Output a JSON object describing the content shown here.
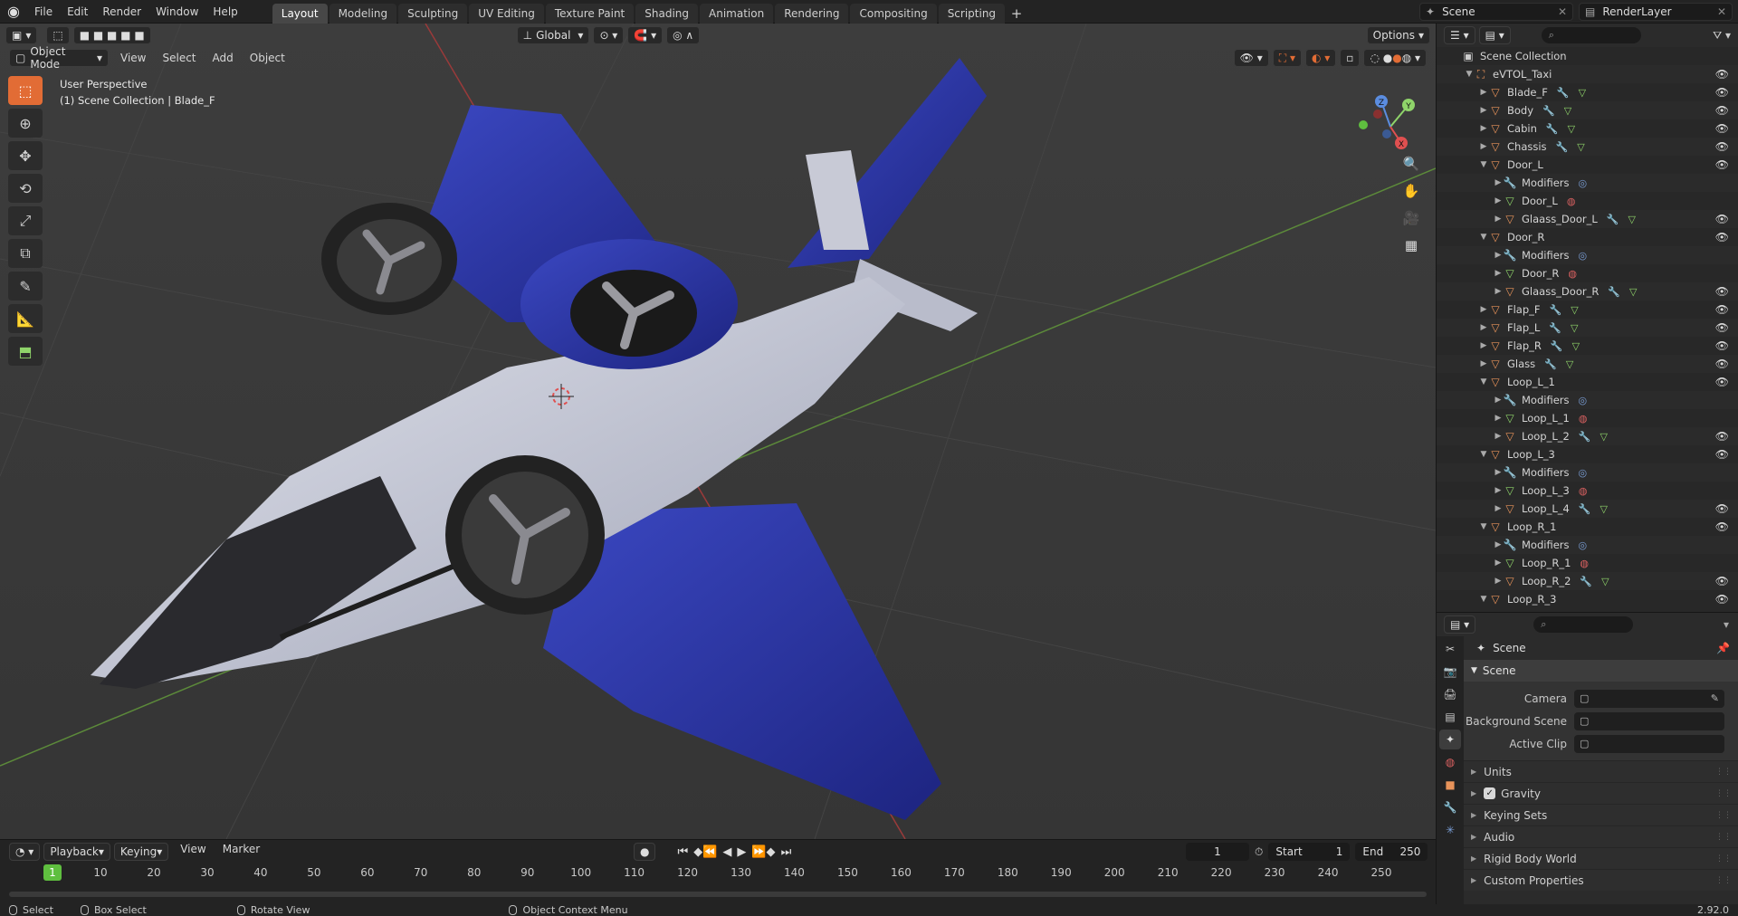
{
  "topbar": {
    "menus": [
      "File",
      "Edit",
      "Render",
      "Window",
      "Help"
    ],
    "workspaces": [
      "Layout",
      "Modeling",
      "Sculpting",
      "UV Editing",
      "Texture Paint",
      "Shading",
      "Animation",
      "Rendering",
      "Compositing",
      "Scripting"
    ],
    "active_workspace": "Layout",
    "scene_name": "Scene",
    "view_layer": "RenderLayer"
  },
  "viewport": {
    "mode": "Object Mode",
    "menus": [
      "View",
      "Select",
      "Add",
      "Object"
    ],
    "orientation": "Global",
    "options_label": "Options",
    "info_line1": "User Perspective",
    "info_line2": "(1) Scene Collection | Blade_F",
    "gizmo_labels": {
      "x": "X",
      "y": "Y",
      "z": "Z"
    }
  },
  "outliner": {
    "root": "Scene Collection",
    "rows": [
      {
        "label": "eVTOL_Taxi",
        "indent": 1,
        "icon": "collection",
        "expanded": true,
        "eye": true
      },
      {
        "label": "Blade_F",
        "indent": 2,
        "icon": "object",
        "expanded": false,
        "eye": true,
        "extras": true
      },
      {
        "label": "Body",
        "indent": 2,
        "icon": "object",
        "expanded": false,
        "eye": true,
        "extras": true
      },
      {
        "label": "Cabin",
        "indent": 2,
        "icon": "object",
        "expanded": false,
        "eye": true,
        "extras": true
      },
      {
        "label": "Chassis",
        "indent": 2,
        "icon": "object",
        "expanded": false,
        "eye": true,
        "extras": true
      },
      {
        "label": "Door_L",
        "indent": 2,
        "icon": "object",
        "expanded": true,
        "eye": true
      },
      {
        "label": "Modifiers",
        "indent": 3,
        "icon": "modifier",
        "expanded": false,
        "eye": false,
        "mod": true
      },
      {
        "label": "Door_L",
        "indent": 3,
        "icon": "mesh",
        "expanded": false,
        "eye": false,
        "mat": true
      },
      {
        "label": "Glaass_Door_L",
        "indent": 3,
        "icon": "object",
        "expanded": false,
        "eye": true,
        "extras": true
      },
      {
        "label": "Door_R",
        "indent": 2,
        "icon": "object",
        "expanded": true,
        "eye": true
      },
      {
        "label": "Modifiers",
        "indent": 3,
        "icon": "modifier",
        "expanded": false,
        "eye": false,
        "mod": true
      },
      {
        "label": "Door_R",
        "indent": 3,
        "icon": "mesh",
        "expanded": false,
        "eye": false,
        "mat": true
      },
      {
        "label": "Glaass_Door_R",
        "indent": 3,
        "icon": "object",
        "expanded": false,
        "eye": true,
        "extras": true
      },
      {
        "label": "Flap_F",
        "indent": 2,
        "icon": "object",
        "expanded": false,
        "eye": true,
        "extras": true
      },
      {
        "label": "Flap_L",
        "indent": 2,
        "icon": "object",
        "expanded": false,
        "eye": true,
        "extras": true
      },
      {
        "label": "Flap_R",
        "indent": 2,
        "icon": "object",
        "expanded": false,
        "eye": true,
        "extras": true
      },
      {
        "label": "Glass",
        "indent": 2,
        "icon": "object",
        "expanded": false,
        "eye": true,
        "extras": true
      },
      {
        "label": "Loop_L_1",
        "indent": 2,
        "icon": "object",
        "expanded": true,
        "eye": true
      },
      {
        "label": "Modifiers",
        "indent": 3,
        "icon": "modifier",
        "expanded": false,
        "eye": false,
        "mod": true
      },
      {
        "label": "Loop_L_1",
        "indent": 3,
        "icon": "mesh",
        "expanded": false,
        "eye": false,
        "mat": true
      },
      {
        "label": "Loop_L_2",
        "indent": 3,
        "icon": "object",
        "expanded": false,
        "eye": true,
        "extras": true
      },
      {
        "label": "Loop_L_3",
        "indent": 2,
        "icon": "object",
        "expanded": true,
        "eye": true
      },
      {
        "label": "Modifiers",
        "indent": 3,
        "icon": "modifier",
        "expanded": false,
        "eye": false,
        "mod": true
      },
      {
        "label": "Loop_L_3",
        "indent": 3,
        "icon": "mesh",
        "expanded": false,
        "eye": false,
        "mat": true
      },
      {
        "label": "Loop_L_4",
        "indent": 3,
        "icon": "object",
        "expanded": false,
        "eye": true,
        "extras": true
      },
      {
        "label": "Loop_R_1",
        "indent": 2,
        "icon": "object",
        "expanded": true,
        "eye": true
      },
      {
        "label": "Modifiers",
        "indent": 3,
        "icon": "modifier",
        "expanded": false,
        "eye": false,
        "mod": true
      },
      {
        "label": "Loop_R_1",
        "indent": 3,
        "icon": "mesh",
        "expanded": false,
        "eye": false,
        "mat": true
      },
      {
        "label": "Loop_R_2",
        "indent": 3,
        "icon": "object",
        "expanded": false,
        "eye": true,
        "extras": true
      },
      {
        "label": "Loop_R_3",
        "indent": 2,
        "icon": "object",
        "expanded": true,
        "eye": true
      }
    ]
  },
  "properties": {
    "title": "Scene",
    "panel": "Scene",
    "fields": [
      {
        "label": "Camera"
      },
      {
        "label": "Background Scene"
      },
      {
        "label": "Active Clip"
      }
    ],
    "sub_panels": [
      "Units",
      "Gravity",
      "Keying Sets",
      "Audio",
      "Rigid Body World",
      "Custom Properties"
    ],
    "gravity_checked": true
  },
  "timeline": {
    "menus": [
      "Playback",
      "Keying",
      "View",
      "Marker"
    ],
    "current_frame": "1",
    "start_label": "Start",
    "start": "1",
    "end_label": "End",
    "end": "250",
    "ticks": [
      "1",
      "10",
      "20",
      "30",
      "40",
      "50",
      "60",
      "70",
      "80",
      "90",
      "100",
      "110",
      "120",
      "130",
      "140",
      "150",
      "160",
      "170",
      "180",
      "190",
      "200",
      "210",
      "220",
      "230",
      "240",
      "250"
    ]
  },
  "statusbar": {
    "select": "Select",
    "box_select": "Box Select",
    "rotate_view": "Rotate View",
    "context_menu": "Object Context Menu",
    "version": "2.92.0"
  },
  "colors": {
    "accent": "#4772b3",
    "active_tool": "#e26c35",
    "frame_current": "#5fbf3f",
    "body_blue": "#2f3ba6",
    "body_white": "#c9ccd8"
  }
}
